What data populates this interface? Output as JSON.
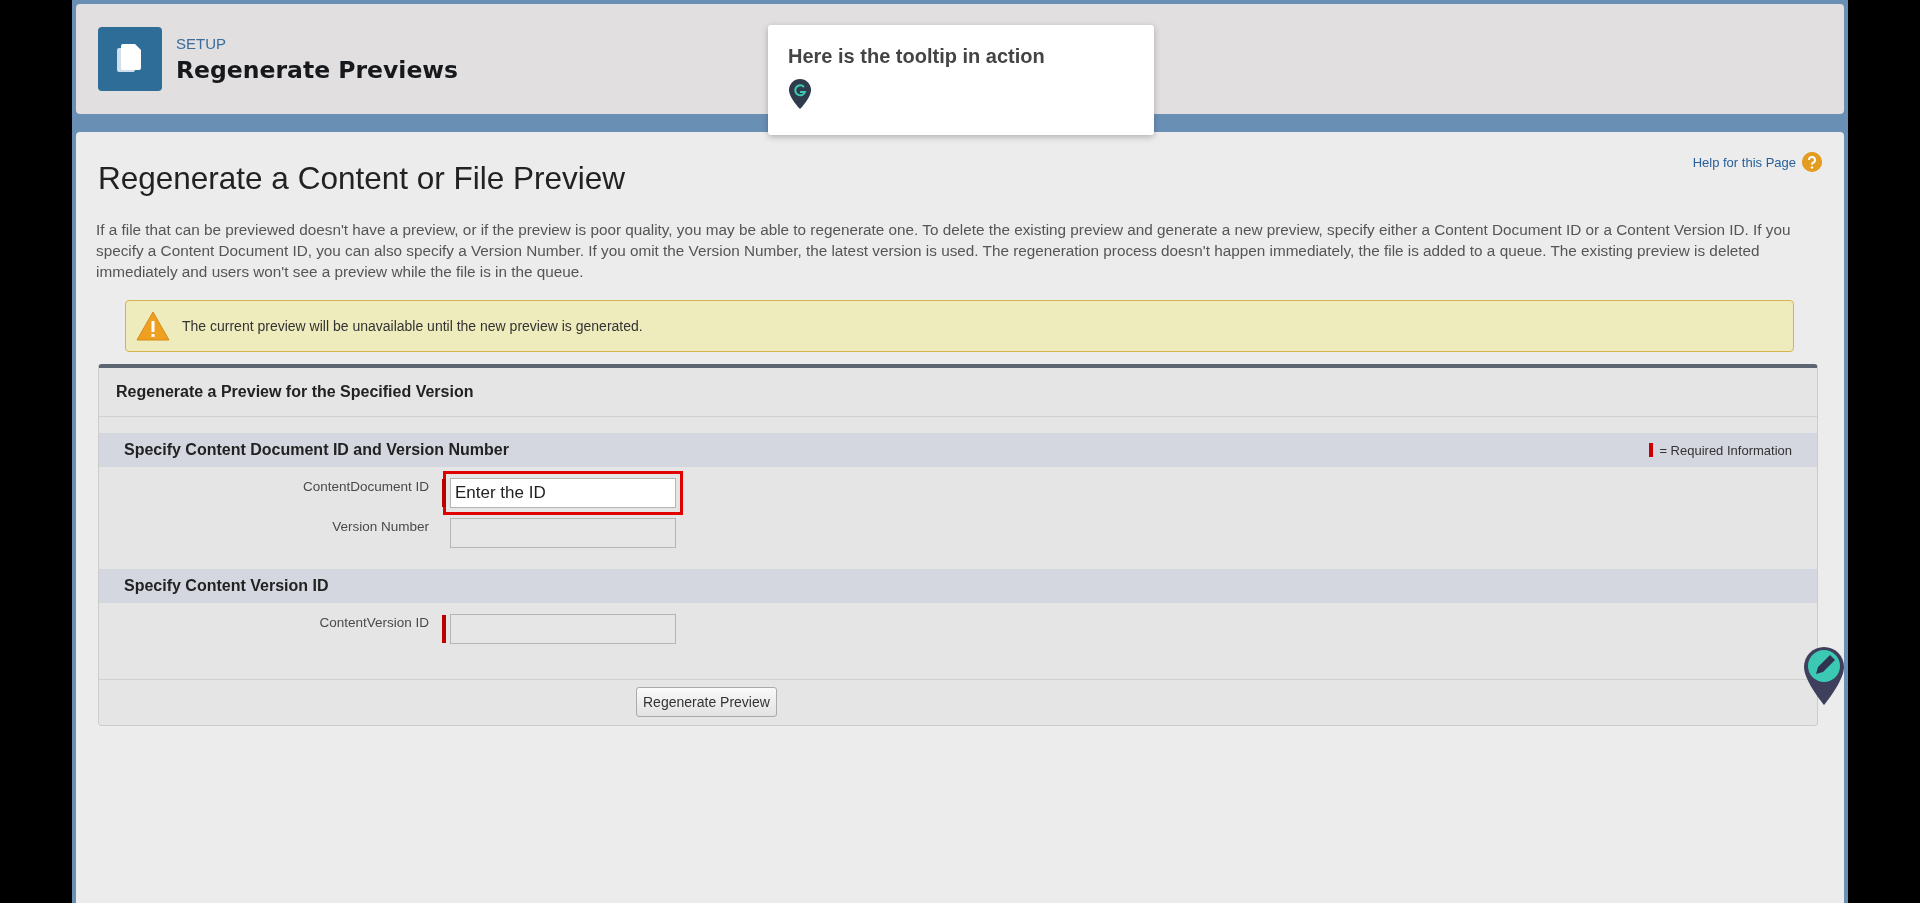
{
  "header": {
    "eyebrow": "SETUP",
    "title": "Regenerate Previews"
  },
  "tooltip": {
    "text": "Here is the tooltip in action"
  },
  "page": {
    "title": "Regenerate a Content or File Preview",
    "help_link": "Help for this Page",
    "description": "If a file that can be previewed doesn't have a preview, or if the preview is poor quality, you may be able to regenerate one. To delete the existing preview and generate a new preview, specify either a Content Document ID or a Content Version ID. If you specify a Content Document ID, you can also specify a Version Number. If you omit the Version Number, the latest version is used. The regeneration process doesn't happen immediately, the file is added to a queue. The existing preview is deleted immediately and users won't see a preview while the file is in the queue."
  },
  "warning": {
    "text": "The current preview will be unavailable until the new preview is generated."
  },
  "panel": {
    "title": "Regenerate a Preview for the Specified Version",
    "required_legend": "= Required Information",
    "sections": [
      {
        "title": "Specify Content Document ID and Version Number",
        "fields": [
          {
            "label": "ContentDocument ID",
            "value": "Enter the ID",
            "required": true,
            "highlighted": true
          },
          {
            "label": "Version Number",
            "required": false,
            "highlighted": false
          }
        ]
      },
      {
        "title": "Specify Content Version ID",
        "fields": [
          {
            "label": "ContentVersion ID",
            "required": true,
            "highlighted": false
          }
        ]
      }
    ],
    "button": "Regenerate Preview"
  }
}
